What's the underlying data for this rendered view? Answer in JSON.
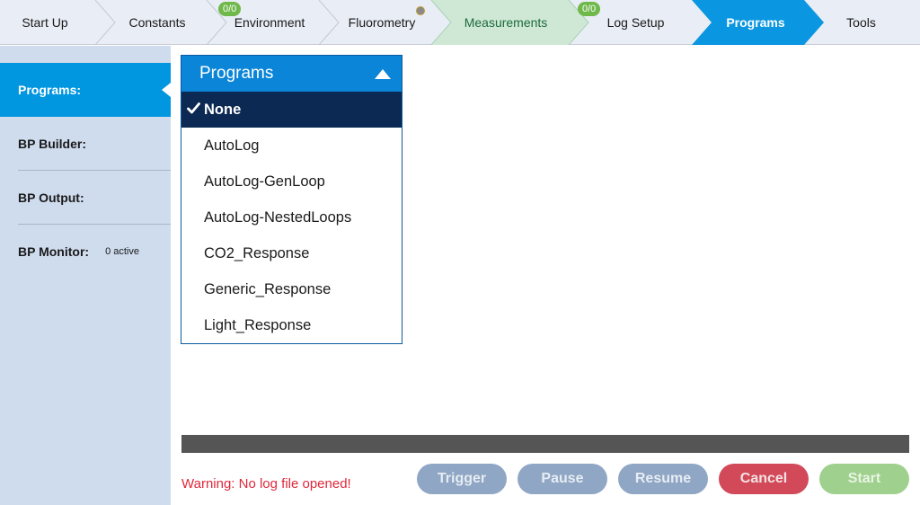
{
  "nav": {
    "tabs": [
      {
        "label": "Start Up"
      },
      {
        "label": "Constants"
      },
      {
        "label": "Environment",
        "badge": "0/0"
      },
      {
        "label": "Fluorometry"
      },
      {
        "label": "Measurements"
      },
      {
        "label": "Log Setup",
        "badge": "0/0"
      },
      {
        "label": "Programs"
      },
      {
        "label": "Tools"
      }
    ],
    "active_tab": "Programs",
    "colors": {
      "bar": "#e9edf5",
      "active": "#0a96e0",
      "measurements": "#cfe8d6",
      "badge": "#6fb84a"
    }
  },
  "sidebar": {
    "items": [
      {
        "label": "Programs:"
      },
      {
        "label": "BP Builder:"
      },
      {
        "label": "BP Output:"
      },
      {
        "label": "BP Monitor:",
        "sub": "0 active"
      }
    ],
    "active_item": "Programs:"
  },
  "dropdown": {
    "header": "Programs",
    "options": [
      "None",
      "AutoLog",
      "AutoLog-GenLoop",
      "AutoLog-NestedLoops",
      "CO2_Response",
      "Generic_Response",
      "Light_Response"
    ],
    "selected": "None"
  },
  "warning": "Warning: No log file opened!",
  "buttons": {
    "trigger": "Trigger",
    "pause": "Pause",
    "resume": "Resume",
    "cancel": "Cancel",
    "start": "Start"
  }
}
